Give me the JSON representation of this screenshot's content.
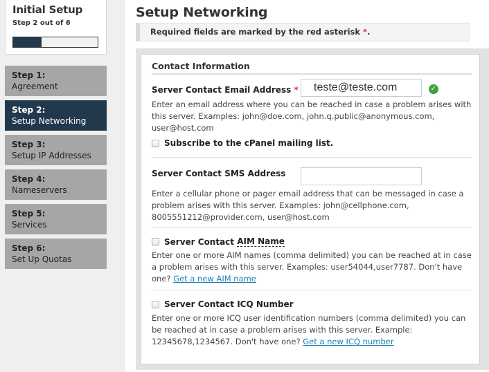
{
  "sidebar": {
    "title": "Initial Setup",
    "subtitle": "Step 2 out of 6",
    "progress": {
      "current": 2,
      "total": 6,
      "fraction": 0.333,
      "fill_color": "#22384d"
    },
    "steps": [
      {
        "num": "Step 1:",
        "name": "Agreement",
        "active": false
      },
      {
        "num": "Step 2:",
        "name": "Setup Networking",
        "active": true
      },
      {
        "num": "Step 3:",
        "name": "Setup IP Addresses",
        "active": false
      },
      {
        "num": "Step 4:",
        "name": "Nameservers",
        "active": false
      },
      {
        "num": "Step 5:",
        "name": "Services",
        "active": false
      },
      {
        "num": "Step 6:",
        "name": "Set Up Quotas",
        "active": false
      }
    ]
  },
  "main": {
    "title": "Setup Networking",
    "notice": {
      "text": "Required fields are marked by the red asterisk ",
      "asterisk": "*",
      "end": "."
    },
    "section_title": "Contact Information",
    "email": {
      "label": "Server Contact Email Address ",
      "required": "*",
      "value": "teste@teste.com",
      "status_icon": "check-circle-icon",
      "help": "Enter an email address where you can be reached in case a problem arises with this server. Examples: john@doe.com, john.q.public@anonymous.com, user@host.com"
    },
    "subscribe": {
      "label": "Subscribe to the cPanel mailing list.",
      "checked": false
    },
    "sms": {
      "label": "Server Contact SMS Address",
      "value": "",
      "help": "Enter a cellular phone or pager email address that can be messaged in case a problem arises with this server. Examples: john@cellphone.com, 8005551212@provider.com, user@host.com"
    },
    "aim": {
      "label_prefix": "Server Contact ",
      "label_abbr": "AIM Name",
      "checked": false,
      "help": "Enter one or more AIM names (comma delimited) you can be reached at in case a problem arises with this server. Examples: user54044,user7787. Don't have one? ",
      "link": "Get a new AIM name"
    },
    "icq": {
      "label": "Server Contact ICQ Number",
      "checked": false,
      "help": "Enter one or more ICQ user identification numbers (comma delimited) you can be reached at in case a problem arises with this server. Example: 12345678,1234567. Don't have one? ",
      "link": "Get a new ICQ number"
    }
  }
}
